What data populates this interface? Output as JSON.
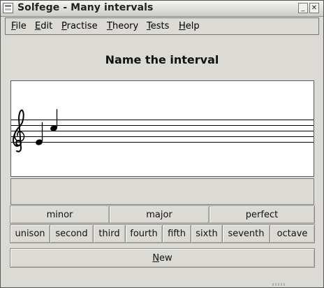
{
  "window": {
    "title": "Solfege - Many intervals"
  },
  "menubar": {
    "items": [
      {
        "label": "File",
        "mnemonic": "F",
        "rest": "ile"
      },
      {
        "label": "Edit",
        "mnemonic": "E",
        "rest": "dit"
      },
      {
        "label": "Practise",
        "mnemonic": "P",
        "rest": "ractise"
      },
      {
        "label": "Theory",
        "mnemonic": "T",
        "rest": "heory"
      },
      {
        "label": "Tests",
        "mnemonic": "T",
        "rest": "ests"
      },
      {
        "label": "Help",
        "mnemonic": "H",
        "rest": "elp"
      }
    ]
  },
  "exercise": {
    "prompt": "Name the interval",
    "feedback": ""
  },
  "staff": {
    "clef": "treble-clef-icon",
    "notes": [
      "E4",
      "B4"
    ]
  },
  "answer_buttons": {
    "qualities": [
      "minor",
      "major",
      "perfect"
    ],
    "intervals": [
      "unison",
      "second",
      "third",
      "fourth",
      "fifth",
      "sixth",
      "seventh",
      "octave"
    ]
  },
  "new_button": {
    "label": "New",
    "mnemonic": "N",
    "rest": "ew"
  },
  "colors": {
    "window_bg": "#dcdad5",
    "staff_bg": "#ffffff",
    "border": "#555555"
  }
}
